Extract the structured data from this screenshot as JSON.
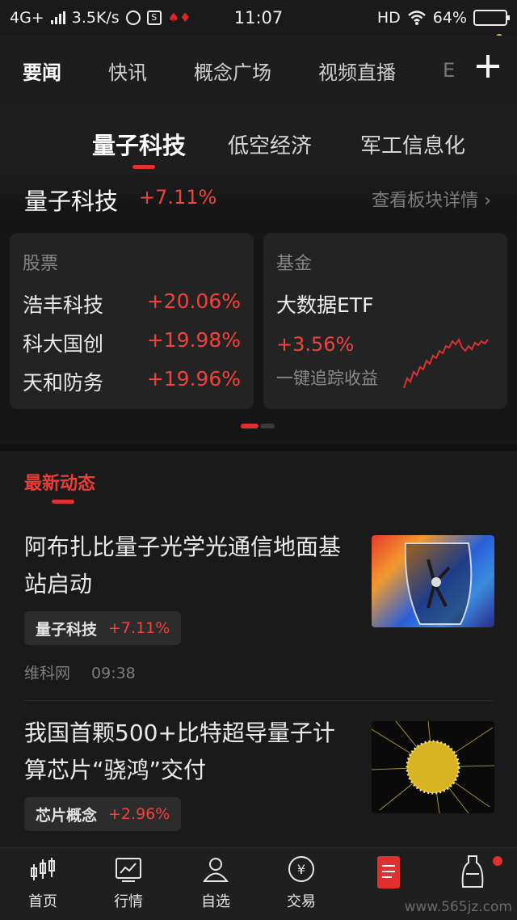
{
  "status_bar": {
    "network": "4G+",
    "speed": "3.5K/s",
    "time": "11:07",
    "hd": "HD",
    "battery": "64%"
  },
  "top_nav": {
    "tabs": [
      "要闻",
      "快讯",
      "概念广场",
      "视频直播",
      "E"
    ],
    "active_index": 0,
    "add_icon": "plus-icon"
  },
  "sector_tabs": {
    "tabs": [
      "量子科技",
      "低空经济",
      "军工信息化"
    ],
    "active_index": 0
  },
  "sector_header": {
    "name": "量子科技",
    "change": "+7.11%",
    "more_link": "查看板块详情"
  },
  "stocks_card": {
    "title": "股票",
    "rows": [
      {
        "name": "浩丰科技",
        "change": "+20.06%"
      },
      {
        "name": "科大国创",
        "change": "+19.98%"
      },
      {
        "name": "天和防务",
        "change": "+19.96%"
      }
    ]
  },
  "fund_card": {
    "title": "基金",
    "name": "大数据ETF",
    "change": "+3.56%",
    "desc": "一键追踪收益"
  },
  "news": {
    "section_title": "最新动态",
    "items": [
      {
        "headline": "阿布扎比量子光学光通信地面基站启动",
        "tag_name": "量子科技",
        "tag_change": "+7.11%",
        "source": "维科网",
        "time": "09:38"
      },
      {
        "headline": "我国首颗500+比特超导量子计算芯片“骁鸿”交付",
        "tag_name": "芯片概念",
        "tag_change": "+2.96%"
      }
    ]
  },
  "bottom_nav": {
    "items": [
      "首页",
      "行情",
      "自选",
      "交易",
      "",
      ""
    ]
  },
  "watermark": "www.565jz.com",
  "colors": {
    "accent": "#e0302f",
    "up": "#f0423d",
    "background": "#161616"
  }
}
